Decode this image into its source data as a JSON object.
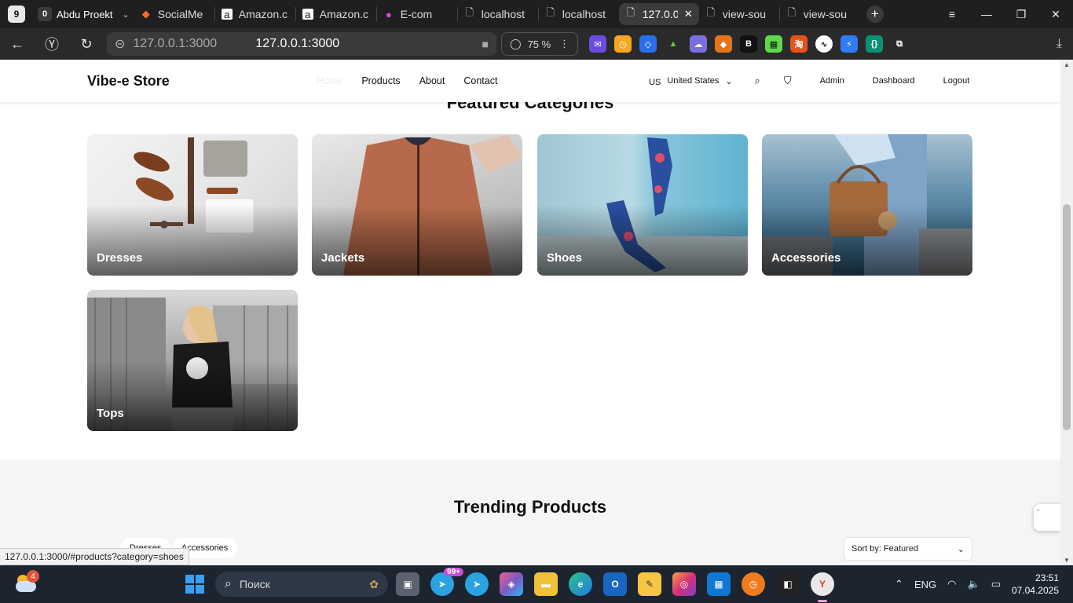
{
  "browser": {
    "tab_count": "9",
    "tab_group": {
      "badge": "0",
      "label": "Abdu Proekt"
    },
    "tabs": [
      {
        "title": "SocialMe",
        "icon": "socialmedia-favicon",
        "color": "#ff6a2b"
      },
      {
        "title": "Amazon.c",
        "icon": "amazon-favicon",
        "color": "#ffffff"
      },
      {
        "title": "Amazon.c",
        "icon": "amazon-favicon",
        "color": "#ffffff"
      },
      {
        "title": "E-com",
        "icon": "ecommerce-favicon",
        "color": "#d14fd0"
      },
      {
        "title": "localhost",
        "icon": "document-favicon",
        "color": "#dddddd"
      },
      {
        "title": "localhost",
        "icon": "document-favicon",
        "color": "#dddddd"
      },
      {
        "title": "127.0.0",
        "icon": "document-favicon",
        "color": "#ffffff",
        "active": true
      },
      {
        "title": "view-sou",
        "icon": "document-favicon",
        "color": "#dddddd"
      },
      {
        "title": "view-sou",
        "icon": "document-favicon",
        "color": "#dddddd"
      }
    ],
    "address_short": "127.0.0.1:3000",
    "address_full": "127.0.0.1:3000",
    "zoom": "75 %",
    "status_url": "127.0.0.1:3000/#products?category=shoes"
  },
  "site": {
    "brand": "Vibe-e Store",
    "nav": {
      "home": "Home",
      "products": "Products",
      "about": "About",
      "contact": "Contact"
    },
    "country_code": "US",
    "country": "United States",
    "admin": "Admin",
    "dashboard": "Dashboard",
    "logout": "Logout",
    "featured_title": "Featured Categories",
    "categories": [
      {
        "name": "Dresses"
      },
      {
        "name": "Jackets"
      },
      {
        "name": "Shoes"
      },
      {
        "name": "Accessories"
      },
      {
        "name": "Tops"
      }
    ],
    "trending_title": "Trending Products",
    "filter_pills": [
      "Dresses",
      "Accessories"
    ],
    "sort_label": "Sort by: Featured"
  },
  "taskbar": {
    "weather_badge": "4",
    "search_placeholder": "Поиск",
    "telegram_badge": "99+",
    "language": "ENG",
    "time": "23:51",
    "date": "07.04.2025"
  }
}
